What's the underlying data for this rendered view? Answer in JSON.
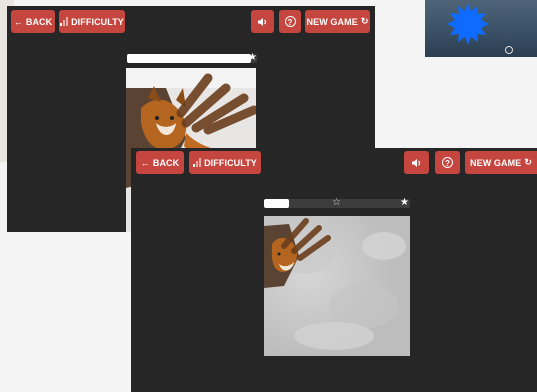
{
  "toolbar": {
    "back_label": "BACK",
    "difficulty_label": "DIFFICULTY",
    "new_game_label": "NEW GAME",
    "back_icon": "arrow-left-icon",
    "difficulty_icon": "signal-bars-icon",
    "sound_icon": "speaker-icon",
    "help_icon": "question-circle-icon",
    "new_game_icon": "refresh-icon"
  },
  "glyphs": {
    "arrow_left": "←",
    "speaker": "🔊",
    "question": "?",
    "refresh": "↻",
    "star_filled": "★",
    "star_hollow": "☆"
  },
  "back_window": {
    "progress": 0.95
  },
  "front_window": {
    "progress": 0.17
  },
  "thumbnail": {
    "shape": "blue-sun-icon"
  },
  "colors": {
    "button": "#c5463f",
    "window": "#262626",
    "accent_blue": "#0f6bff"
  }
}
